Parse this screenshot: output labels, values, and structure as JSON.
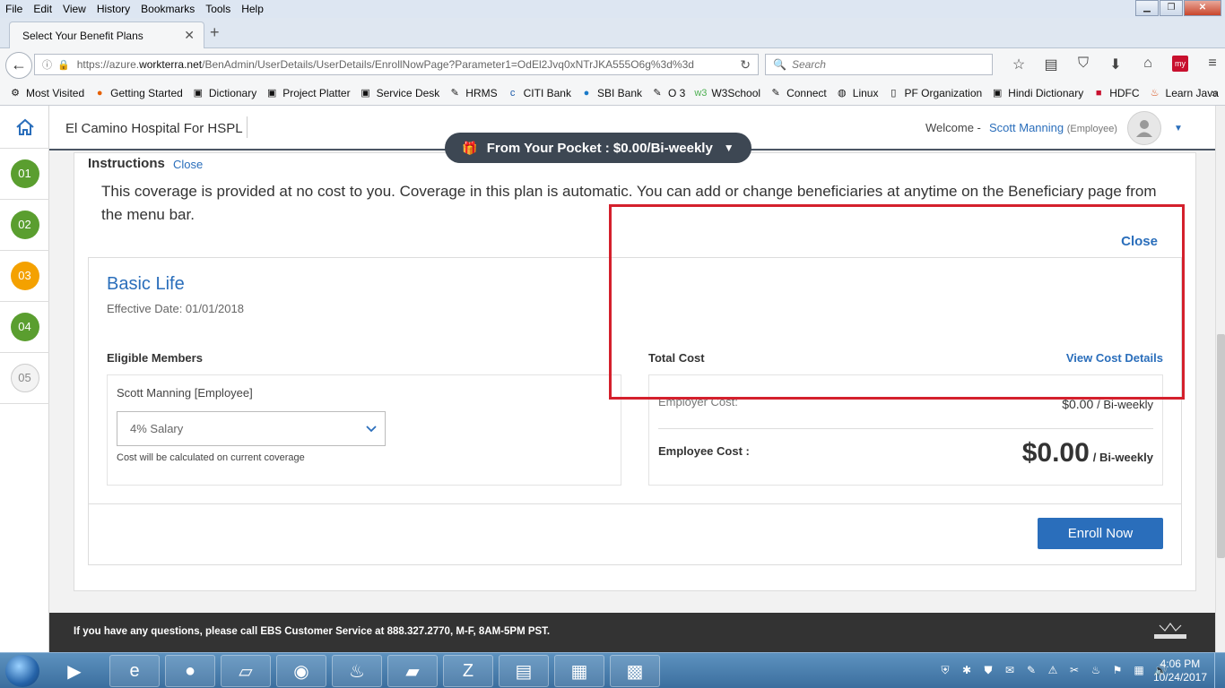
{
  "browser": {
    "menu": [
      "File",
      "Edit",
      "View",
      "History",
      "Bookmarks",
      "Tools",
      "Help"
    ],
    "tab_title": "Select Your Benefit Plans",
    "url_prefix": "https://azure.",
    "url_domain": "workterra.net",
    "url_rest": "/BenAdmin/UserDetails/UserDetails/EnrollNowPage?Parameter1=OdEl2Jvq0xNTrJKA555O6g%3d%3d",
    "search_placeholder": "Search",
    "bookmarks": [
      "Most Visited",
      "Getting Started",
      "Dictionary",
      "Project Platter",
      "Service Desk",
      "HRMS",
      "CITI Bank",
      "SBI Bank",
      "O 3",
      "W3School",
      "Connect",
      "Linux",
      "PF Organization",
      "Hindi Dictionary",
      "HDFC",
      "Learn Java"
    ]
  },
  "nav": {
    "steps": [
      "01",
      "02",
      "03",
      "04",
      "05"
    ]
  },
  "header": {
    "company": "El Camino Hospital For HSPL",
    "welcome": "Welcome -",
    "user_name": "Scott Manning",
    "user_role": "(Employee)"
  },
  "pocket": {
    "label": "From Your Pocket : $0.00/Bi-weekly"
  },
  "instructions": {
    "title": "Instructions",
    "close": "Close",
    "text": "This coverage is provided at no cost to you. Coverage in this plan is automatic. You can add or change beneficiaries at anytime on the Beneficiary page from the menu bar.",
    "close2": "Close"
  },
  "plan": {
    "name": "Basic Life",
    "effective": "Effective Date: 01/01/2018",
    "eligible_label": "Eligible Members",
    "member": "Scott Manning [Employee]",
    "coverage_selected": "4% Salary",
    "cost_note": "Cost will be calculated on current coverage",
    "total_label": "Total Cost",
    "view_cost": "View Cost Details",
    "employer_label": "Employer Cost:",
    "employer_value": "$0.00",
    "employer_unit": "/ Bi-weekly",
    "employee_label": "Employee Cost :",
    "employee_value": "$0.00",
    "employee_unit": "/ Bi-weekly",
    "enroll": "Enroll Now"
  },
  "footer": {
    "text": "If you have any questions, please call EBS Customer Service at 888.327.2770, M-F, 8AM-5PM PST."
  },
  "taskbar": {
    "time": "4:06 PM",
    "date": "10/24/2017"
  },
  "colors": {
    "accent": "#2a6ebb",
    "step_done": "#5a9e2f",
    "step_current": "#f4a100",
    "highlight": "#d4202c"
  }
}
